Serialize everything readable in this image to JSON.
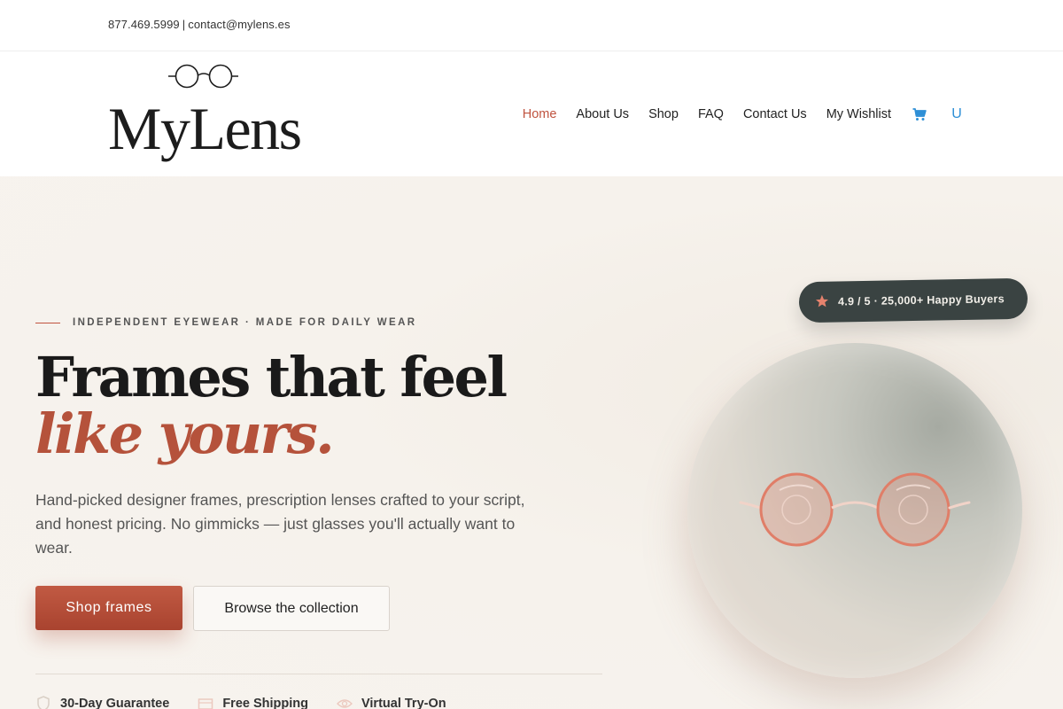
{
  "topbar": {
    "phone": "877.469.5999",
    "separator": "|",
    "email": "contact@mylens.es"
  },
  "brand": {
    "logo_text": "MyLens",
    "accent_color": "#c0533f"
  },
  "nav": {
    "items": [
      {
        "label": "Home",
        "active": true
      },
      {
        "label": "About Us",
        "active": false
      },
      {
        "label": "Shop",
        "active": false
      },
      {
        "label": "FAQ",
        "active": false
      },
      {
        "label": "Contact Us",
        "active": false
      },
      {
        "label": "My Wishlist",
        "active": false
      }
    ],
    "cart_icon": "cart-icon",
    "search_icon": "search-icon",
    "search_glyph": "U"
  },
  "hero": {
    "eyebrow": "INDEPENDENT EYEWEAR · MADE FOR DAILY WEAR",
    "headline": "Frames that feel",
    "headline_accent": "like yours.",
    "subtext": "Hand-picked designer frames, prescription lenses crafted to your script, and honest pricing. No gimmicks — just glasses you'll actually want to wear.",
    "primary_button": "Shop frames",
    "secondary_button": "Browse the collection",
    "perks": [
      {
        "label": "30-Day Guarantee",
        "icon": "shield-icon"
      },
      {
        "label": "Free Shipping",
        "icon": "box-icon"
      },
      {
        "label": "Virtual Try-On",
        "icon": "eye-icon"
      }
    ],
    "rating": "4.9 / 5 · 25,000+ Happy Buyers",
    "rating_icon": "star-icon"
  }
}
